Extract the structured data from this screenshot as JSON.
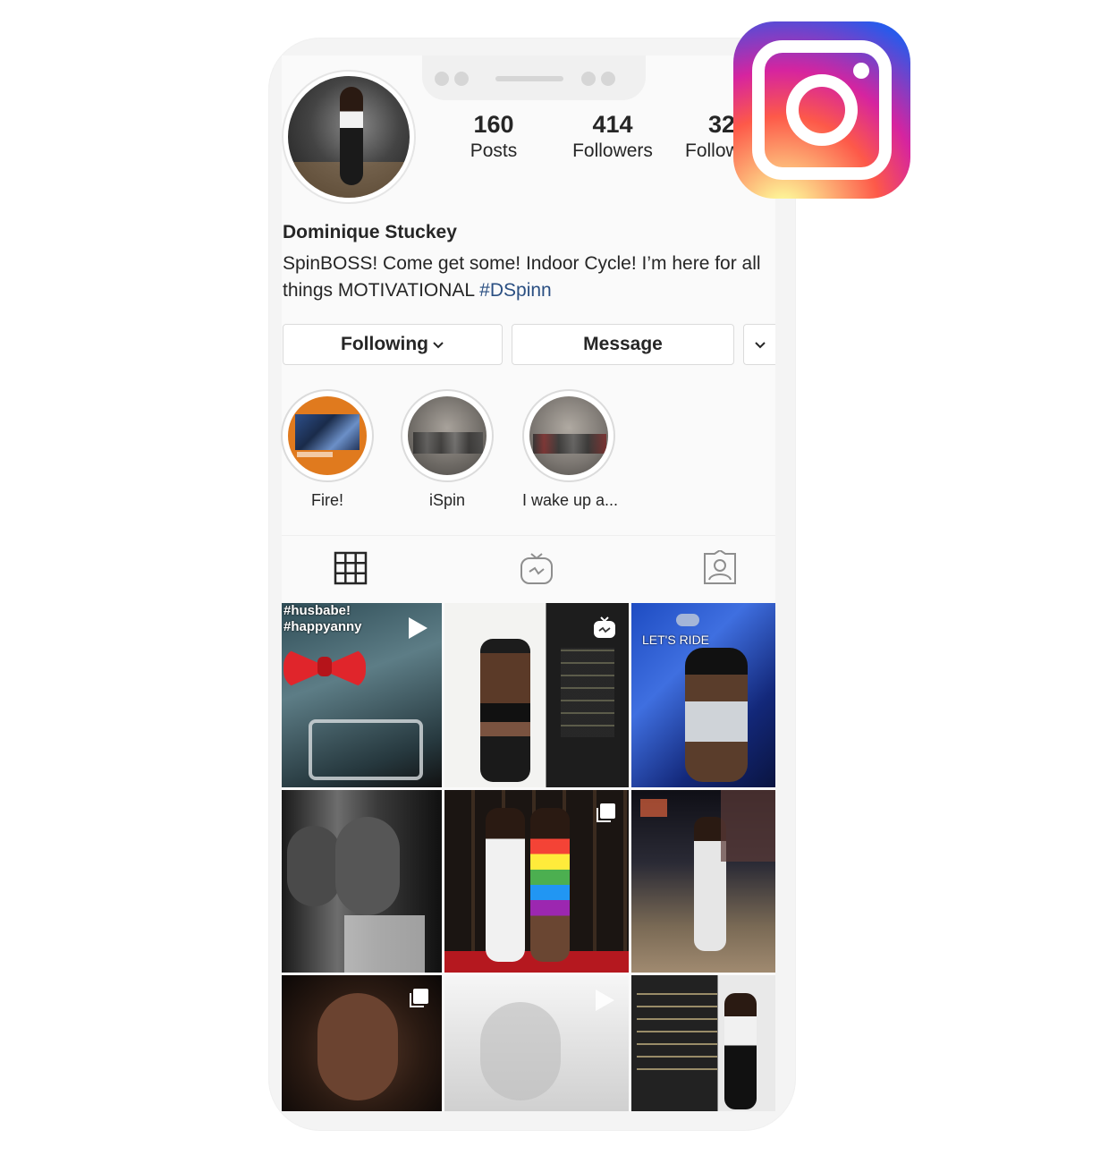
{
  "profile": {
    "name": "Dominique Stuckey",
    "bio_text": "SpinBOSS! Come get some! Indoor Cycle! I’m here for all things MOTIVATIONAL ",
    "bio_hashtag": "#DSpinn"
  },
  "stats": [
    {
      "num": "160",
      "label": "Posts"
    },
    {
      "num": "414",
      "label": "Followers"
    },
    {
      "num": "32",
      "label": "Following"
    }
  ],
  "buttons": {
    "following": "Following",
    "message": "Message"
  },
  "highlights": [
    {
      "label": "Fire!"
    },
    {
      "label": "iSpin"
    },
    {
      "label": "I wake up a..."
    }
  ],
  "tabs": [
    {
      "icon": "grid-icon"
    },
    {
      "icon": "igtv-icon"
    },
    {
      "icon": "tagged-icon"
    }
  ],
  "posts": [
    {
      "caption": "#husbabe!\n#happyanny",
      "overlay": "video"
    },
    {
      "caption": "",
      "overlay": "igtv"
    },
    {
      "caption": "LET'S RIDE",
      "overlay": "none"
    },
    {
      "caption": "",
      "overlay": "none"
    },
    {
      "caption": "",
      "overlay": "carousel"
    },
    {
      "caption": "",
      "overlay": "none"
    },
    {
      "caption": "",
      "overlay": "carousel"
    },
    {
      "caption": "",
      "overlay": "video"
    },
    {
      "caption": "",
      "overlay": "none"
    }
  ],
  "colors": {
    "hashtag": "#2a4f82",
    "border": "#dbdbdb",
    "text": "#262626"
  },
  "brand_logo": "instagram-logo"
}
